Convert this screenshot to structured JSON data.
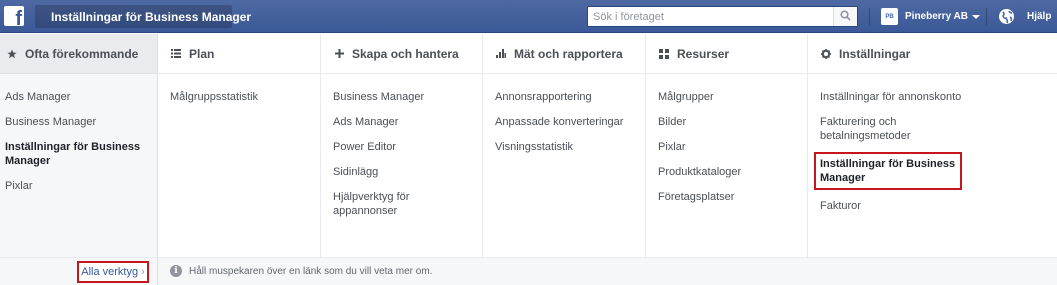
{
  "topbar": {
    "logo": "f",
    "bm_title": "Inställningar för Business Manager",
    "search_placeholder": "Sök i företaget",
    "account_initials": "PB",
    "account_name": "Pineberry AB",
    "help_label": "Hjälp"
  },
  "columns": [
    {
      "heading": "Ofta förekommande",
      "icon": "star-icon",
      "items": [
        "Ads Manager",
        "Business Manager",
        "Inställningar för Business Manager",
        "Pixlar"
      ]
    },
    {
      "heading": "Plan",
      "icon": "list-icon",
      "items": [
        "Målgruppsstatistik"
      ]
    },
    {
      "heading": "Skapa och hantera",
      "icon": "plus-icon",
      "items": [
        "Business Manager",
        "Ads Manager",
        "Power Editor",
        "Sidinlägg",
        "Hjälpverktyg för appannonser"
      ]
    },
    {
      "heading": "Mät och rapportera",
      "icon": "bar-chart-icon",
      "items": [
        "Annonsrapportering",
        "Anpassade konverteringar",
        "Visningsstatistik"
      ]
    },
    {
      "heading": "Resurser",
      "icon": "grid-icon",
      "items": [
        "Målgrupper",
        "Bilder",
        "Pixlar",
        "Produktkataloger",
        "Företagsplatser"
      ]
    },
    {
      "heading": "Inställningar",
      "icon": "gear-icon",
      "items": [
        "Inställningar för annonskonto",
        "Fakturering och betalningsmetoder",
        "Inställningar för Business Manager",
        "Fakturor"
      ]
    }
  ],
  "footer": {
    "all_tools": "Alla verktyg",
    "hint": "Håll muspekaren över en länk som du vill veta mer om."
  },
  "colors": {
    "topbar": "#3b5998",
    "highlight_outline": "#c4161c",
    "link": "#365899"
  }
}
